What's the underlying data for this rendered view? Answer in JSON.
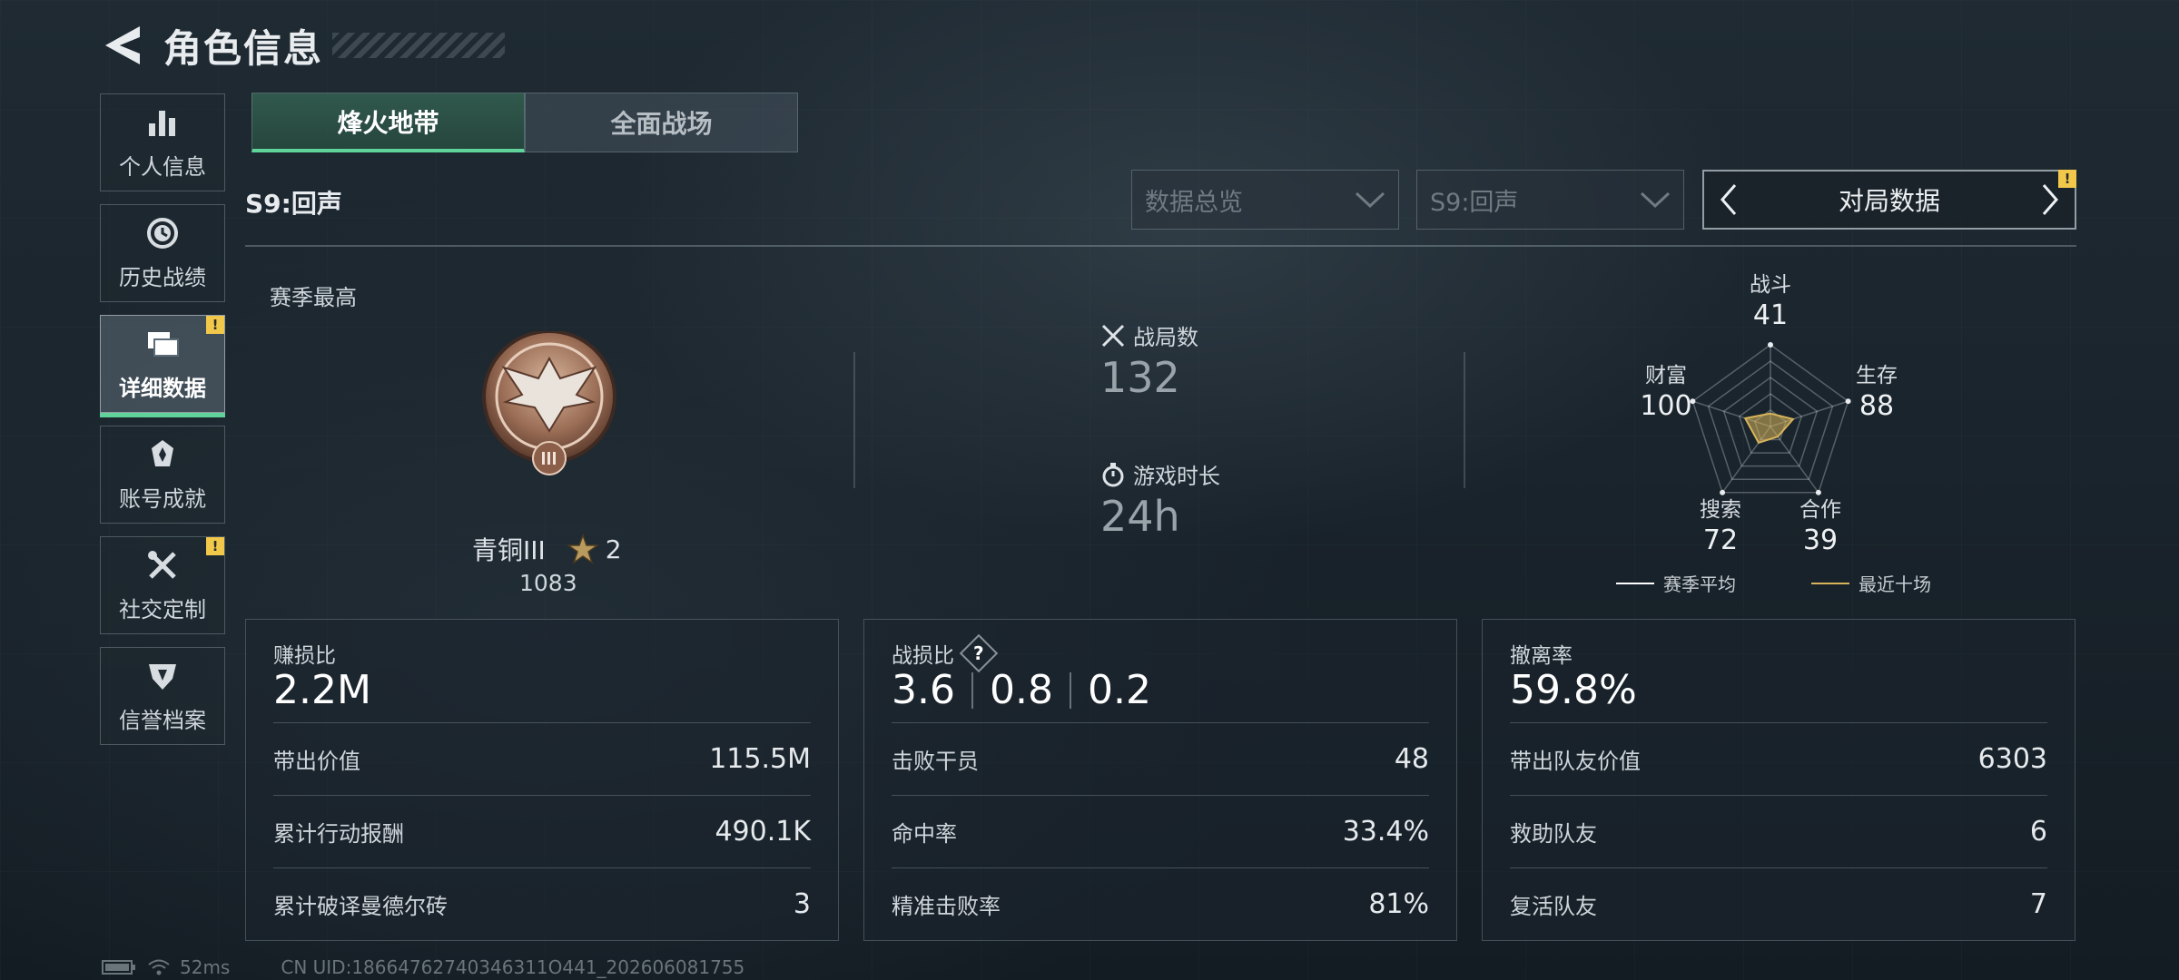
{
  "header": {
    "title": "角色信息"
  },
  "sidebar": {
    "items": [
      {
        "label": "个人信息",
        "icon": "bar-chart-icon",
        "active": false,
        "badge": ""
      },
      {
        "label": "历史战绩",
        "icon": "history-clock-icon",
        "active": false,
        "badge": ""
      },
      {
        "label": "详细数据",
        "icon": "folders-icon",
        "active": true,
        "badge": "!"
      },
      {
        "label": "账号成就",
        "icon": "achievement-icon",
        "active": false,
        "badge": ""
      },
      {
        "label": "社交定制",
        "icon": "tools-icon",
        "active": false,
        "badge": "!"
      },
      {
        "label": "信誉档案",
        "icon": "reputation-icon",
        "active": false,
        "badge": ""
      }
    ]
  },
  "tabs": [
    {
      "label": "烽火地带",
      "active": true
    },
    {
      "label": "全面战场",
      "active": false
    }
  ],
  "season": {
    "label": "S9:回声"
  },
  "filters": {
    "overview": "数据总览",
    "season": "S9:回声",
    "match_nav": "对局数据",
    "match_nav_badge": "!"
  },
  "summary": {
    "season_high_label": "赛季最高",
    "rank_name": "青铜III",
    "rank_stars": "2",
    "rank_points": "1083",
    "matches_label": "战局数",
    "matches_value": "132",
    "playtime_label": "游戏时长",
    "playtime_value": "24h"
  },
  "radar": {
    "axes": [
      {
        "label": "战斗",
        "value": 41
      },
      {
        "label": "生存",
        "value": 88
      },
      {
        "label": "合作",
        "value": 39
      },
      {
        "label": "搜索",
        "value": 72
      },
      {
        "label": "财富",
        "value": 100
      }
    ],
    "legend": {
      "season_avg": "赛季平均",
      "recent_ten": "最近十场"
    },
    "colors": {
      "season_avg": "#ffffff",
      "recent_ten": "#d8b45a"
    }
  },
  "cards": {
    "profit": {
      "title": "赚损比",
      "main": "2.2M",
      "rows": [
        {
          "label": "带出价值",
          "value": "115.5M"
        },
        {
          "label": "累计行动报酬",
          "value": "490.1K"
        },
        {
          "label": "累计破译曼德尔砖",
          "value": "3"
        }
      ]
    },
    "kd": {
      "title": "战损比",
      "help": "?",
      "main": [
        "3.6",
        "0.8",
        "0.2"
      ],
      "rows": [
        {
          "label": "击败干员",
          "value": "48"
        },
        {
          "label": "命中率",
          "value": "33.4%"
        },
        {
          "label": "精准击败率",
          "value": "81%"
        }
      ]
    },
    "extract": {
      "title": "撤离率",
      "main": "59.8%",
      "rows": [
        {
          "label": "带出队友价值",
          "value": "6303"
        },
        {
          "label": "救助队友",
          "value": "6"
        },
        {
          "label": "复活队友",
          "value": "7"
        }
      ]
    }
  },
  "footer": {
    "ping": "52ms",
    "uid": "CN UID:18664762740346311O441_202606081755"
  },
  "colors": {
    "accent": "#5fd39a",
    "badge": "#f2c84b"
  }
}
